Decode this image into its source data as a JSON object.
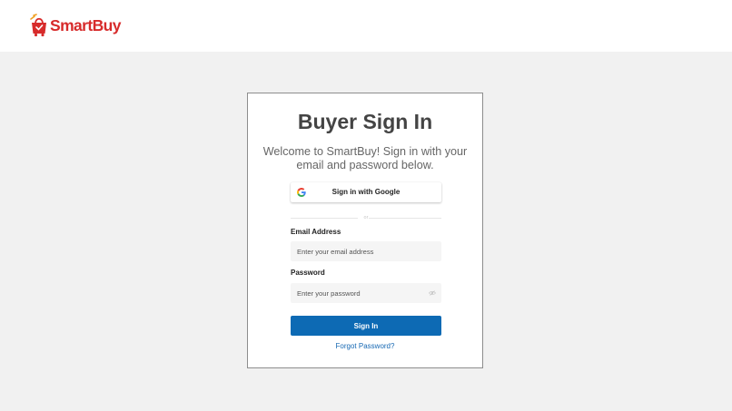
{
  "brand": {
    "name_part1": "Smart",
    "name_part2": "Buy",
    "color": "#d72b2b"
  },
  "login": {
    "title": "Buyer Sign In",
    "subtitle": "Welcome to SmartBuy! Sign in with your email and password below.",
    "google_button_label": "Sign in with Google",
    "divider_text": "or",
    "email_label": "Email Address",
    "email_placeholder": "Enter your email address",
    "email_value": "",
    "password_label": "Password",
    "password_placeholder": "Enter your password",
    "password_value": "",
    "submit_label": "Sign In",
    "forgot_label": "Forgot Password?"
  },
  "icons": {
    "logo": "shopping-bag-icon",
    "google": "google-g-icon",
    "password_toggle": "eye-slash-icon"
  },
  "colors": {
    "primary_button": "#0d6ab4",
    "link": "#1668b3",
    "page_background": "#f1f1f1",
    "title_text": "#444444"
  }
}
